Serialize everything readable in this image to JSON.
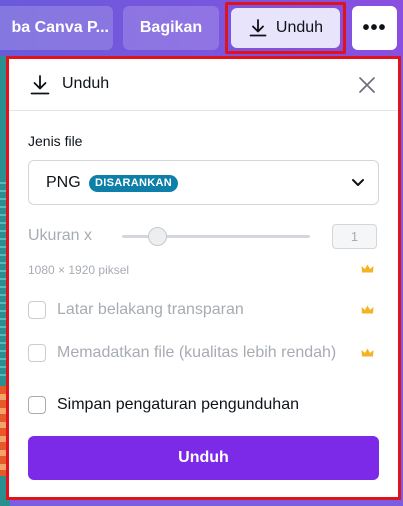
{
  "topbar": {
    "try_label": "ba Canva P...",
    "share_label": "Bagikan",
    "download_label": "Unduh",
    "more_label": "•••"
  },
  "panel": {
    "title": "Unduh",
    "file_type": {
      "label": "Jenis file",
      "value": "PNG",
      "badge": "DISARANKAN"
    },
    "size": {
      "label": "Ukuran x",
      "value": "1",
      "dimensions": "1080 × 1920 piksel"
    },
    "options": {
      "transparent_bg": "Latar belakang transparan",
      "compress": "Memadatkan file (kualitas lebih rendah)",
      "save_settings": "Simpan pengaturan pengunduhan"
    },
    "download_button": "Unduh"
  },
  "icons": {
    "download": "download-icon",
    "close": "close-icon",
    "chevron": "chevron-down-icon",
    "premium": "crown-icon"
  },
  "colors": {
    "topbar": "#7b55de",
    "primary": "#7d2ae8",
    "badge": "#0d7fa8",
    "crown": "#f3b322",
    "highlight_border": "#e0121b"
  }
}
